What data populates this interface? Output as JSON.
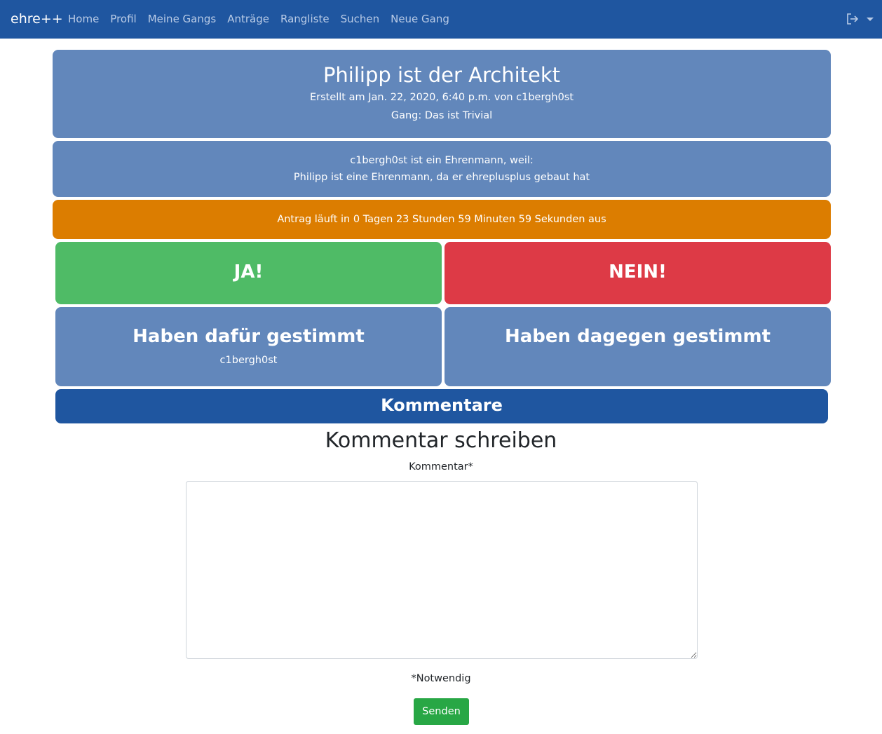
{
  "navbar": {
    "brand": "ehre++",
    "links": [
      "Home",
      "Profil",
      "Meine Gangs",
      "Anträge",
      "Rangliste",
      "Suchen",
      "Neue Gang"
    ],
    "logout_icon": "logout-icon"
  },
  "proposal": {
    "title": "Philipp ist der Architekt",
    "created": "Erstellt am Jan. 22, 2020, 6:40 p.m. von c1bergh0st",
    "gang": "Gang: Das ist Trivial",
    "reason_line1": "c1bergh0st ist ein Ehrenmann, weil:",
    "reason_line2": "Philipp ist eine Ehrenmann, da er ehreplusplus gebaut hat",
    "timer": "Antrag läuft in 0 Tagen 23 Stunden 59 Minuten 59 Sekunden aus"
  },
  "vote": {
    "yes_label": "JA!",
    "no_label": "NEIN!"
  },
  "voters": {
    "for_title": "Haben dafür gestimmt",
    "for_list": [
      "c1bergh0st"
    ],
    "against_title": "Haben dagegen gestimmt",
    "against_list": []
  },
  "comments": {
    "header": "Kommentare",
    "form_title": "Kommentar schreiben",
    "field_label": "Kommentar*",
    "required_note": "*Notwendig",
    "submit_label": "Senden"
  },
  "colors": {
    "navbar": "#1f56a0",
    "card": "#6287bb",
    "timer": "#dc7d00",
    "yes": "#4fbb66",
    "no": "#dd3a46",
    "submit": "#28a745"
  }
}
